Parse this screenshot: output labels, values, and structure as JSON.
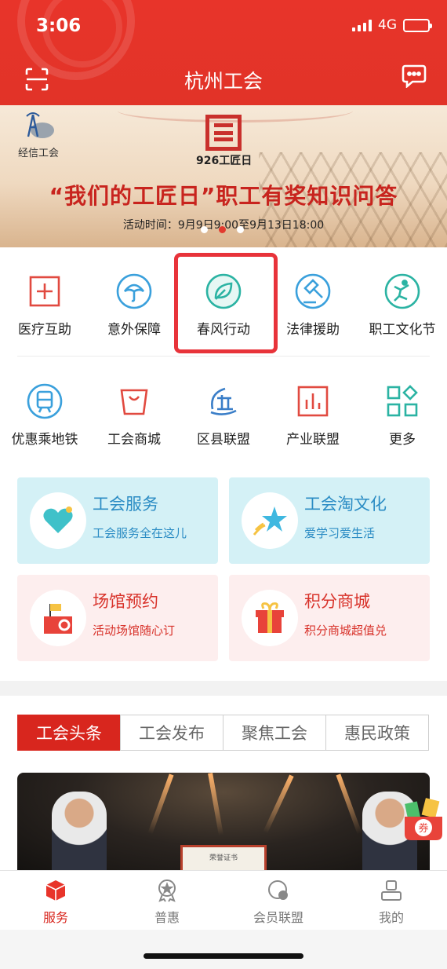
{
  "status_bar": {
    "time": "3:06",
    "network": "4G"
  },
  "header": {
    "title": "杭州工会"
  },
  "banner": {
    "org_label": "经信工会",
    "logo_sub": "926工匠日",
    "headline": "“我们的工匠日”职工有奖知识问答",
    "time_text": "活动时间：9月9日9:00至9月13日18:00",
    "page_count": 3,
    "active_page": 2
  },
  "services": {
    "row1": [
      {
        "label": "医疗互助",
        "icon": "medical-plus-icon"
      },
      {
        "label": "意外保障",
        "icon": "umbrella-icon"
      },
      {
        "label": "春风行动",
        "icon": "leaf-icon"
      },
      {
        "label": "法律援助",
        "icon": "gavel-icon"
      },
      {
        "label": "职工文化节",
        "icon": "dancer-icon"
      }
    ],
    "row2": [
      {
        "label": "优惠乘地铁",
        "icon": "metro-icon"
      },
      {
        "label": "工会商城",
        "icon": "shopping-bag-icon"
      },
      {
        "label": "区县联盟",
        "icon": "district-icon"
      },
      {
        "label": "产业联盟",
        "icon": "bar-chart-icon"
      },
      {
        "label": "更多",
        "icon": "grid-more-icon"
      }
    ],
    "highlighted": "春风行动"
  },
  "cards": [
    {
      "title": "工会服务",
      "subtitle": "工会服务全在这儿",
      "icon": "heart-icon",
      "theme": "blue"
    },
    {
      "title": "工会淘文化",
      "subtitle": "爱学习爱生活",
      "icon": "star-icon",
      "theme": "blue"
    },
    {
      "title": "场馆预约",
      "subtitle": "活动场馆随心订",
      "icon": "venue-flag-icon",
      "theme": "pink"
    },
    {
      "title": "积分商城",
      "subtitle": "积分商城超值兑",
      "icon": "gift-icon",
      "theme": "pink"
    }
  ],
  "news": {
    "tabs": [
      "工会头条",
      "工会发布",
      "聚焦工会",
      "惠民政策"
    ],
    "active_tab": "工会头条",
    "image_caption": "荣誉证书",
    "coupon_label": "券"
  },
  "tabbar": {
    "items": [
      {
        "label": "服务",
        "icon": "service-cube-icon",
        "active": true
      },
      {
        "label": "普惠",
        "icon": "medal-icon",
        "active": false
      },
      {
        "label": "会员联盟",
        "icon": "member-circle-icon",
        "active": false
      },
      {
        "label": "我的",
        "icon": "profile-icon",
        "active": false
      }
    ]
  },
  "colors": {
    "brand_red": "#e8342a",
    "accent_teal": "#2bb3a3",
    "accent_blue": "#2b8cc4"
  }
}
